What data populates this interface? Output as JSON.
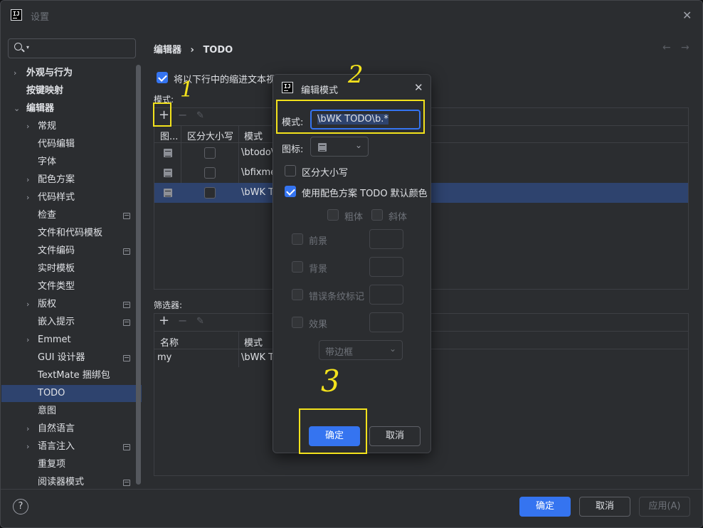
{
  "window": {
    "title": "设置",
    "logo": "IJ"
  },
  "sidebar": {
    "items": [
      {
        "label": "外观与行为",
        "bold": true
      },
      {
        "label": "按键映射",
        "bold": true
      },
      {
        "label": "编辑器",
        "bold": true
      },
      {
        "label": "常规"
      },
      {
        "label": "代码编辑"
      },
      {
        "label": "字体"
      },
      {
        "label": "配色方案"
      },
      {
        "label": "代码样式"
      },
      {
        "label": "检查"
      },
      {
        "label": "文件和代码模板"
      },
      {
        "label": "文件编码"
      },
      {
        "label": "实时模板"
      },
      {
        "label": "文件类型"
      },
      {
        "label": "版权"
      },
      {
        "label": "嵌入提示"
      },
      {
        "label": "Emmet"
      },
      {
        "label": "GUI 设计器"
      },
      {
        "label": "TextMate 捆绑包"
      },
      {
        "label": "TODO",
        "selected": true
      },
      {
        "label": "意图"
      },
      {
        "label": "自然语言"
      },
      {
        "label": "语言注入"
      },
      {
        "label": "重复项"
      },
      {
        "label": "阅读器模式"
      }
    ]
  },
  "breadcrumb": {
    "parent": "编辑器",
    "separator": "›",
    "current": "TODO"
  },
  "main": {
    "indent_checkbox_label": "将以下行中的缩进文本视为",
    "patterns_label": "模式:",
    "patterns_columns": [
      "图...",
      "区分大小写",
      "模式"
    ],
    "patterns_rows": [
      {
        "pattern": "\\btodo\\"
      },
      {
        "pattern": "\\bfixme"
      },
      {
        "pattern": "\\bWK T"
      }
    ],
    "filters_label": "筛选器:",
    "filters_columns": [
      "名称",
      "模式"
    ],
    "filters_rows": [
      {
        "name": "my",
        "pattern": "\\bWK T"
      }
    ]
  },
  "footer": {
    "ok": "确定",
    "cancel": "取消",
    "apply": "应用(A)",
    "help": "?"
  },
  "modal": {
    "title": "编辑模式",
    "pattern_label": "模式:",
    "pattern_value": "\\bWK TODO\\b.*",
    "icon_label": "图标:",
    "case_sensitive_label": "区分大小写",
    "use_color_scheme_label": "使用配色方案 TODO 默认颜色",
    "bold_label": "粗体",
    "italic_label": "斜体",
    "foreground_label": "前景",
    "background_label": "背景",
    "error_stripe_label": "错误条纹标记",
    "effects_label": "效果",
    "effect_type": "带边框",
    "ok": "确定",
    "cancel": "取消"
  },
  "annotations": {
    "one": "1",
    "two": "2",
    "three": "3",
    "color": "#f3e21c"
  }
}
